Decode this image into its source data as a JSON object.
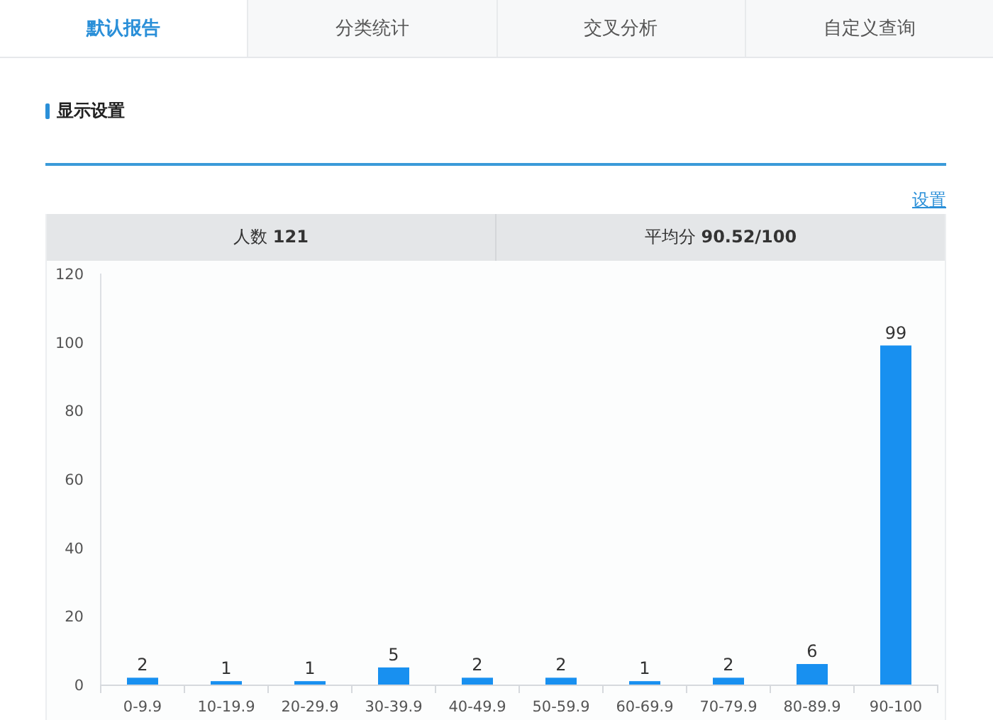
{
  "tabs": [
    {
      "label": "默认报告",
      "selected": true
    },
    {
      "label": "分类统计",
      "selected": false
    },
    {
      "label": "交叉分析",
      "selected": false
    },
    {
      "label": "自定义查询",
      "selected": false
    }
  ],
  "section_title": "显示设置",
  "settings_link": "设置",
  "stats": [
    "人数 **121**",
    "平均分 **90.52/100**"
  ],
  "chart_data": {
    "type": "bar",
    "categories": [
      "0-9.9",
      "10-19.9",
      "20-29.9",
      "30-39.9",
      "40-49.9",
      "50-59.9",
      "60-69.9",
      "70-79.9",
      "80-89.9",
      "90-100"
    ],
    "series": [
      {
        "color": "#1890f0",
        "values": [
          2,
          1,
          1,
          5,
          2,
          2,
          1,
          2,
          6,
          99
        ]
      }
    ],
    "ylim": [
      0,
      120
    ],
    "yticks": [
      0,
      20,
      40,
      60,
      80,
      100,
      120
    ],
    "data_labels": true
  }
}
